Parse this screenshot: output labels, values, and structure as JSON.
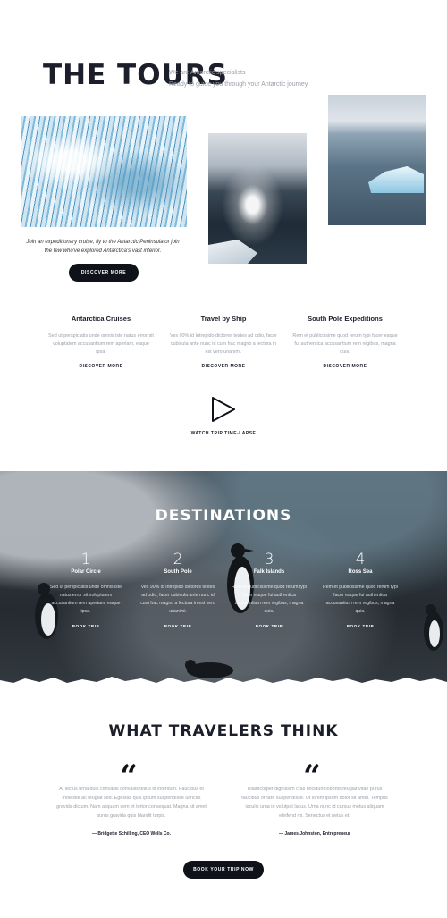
{
  "tours": {
    "title": "THE TOURS",
    "intro_line1": "We are Antarctic specialists",
    "intro_line2": "Ready to guide you through your Antarctic journey.",
    "caption": "Join an expeditionary cruise, fly to the Antarctic Peninsula or join the few who've explored Antarctica's vast interior.",
    "discover_button": "DISCOVER MORE",
    "columns": [
      {
        "title": "Antarctica Cruises",
        "desc": "Sed ut perspiciatis unde omnis iste natus error sit voluptatem accusantium rem aperiam, eaque ipsa.",
        "more": "DISCOVER MORE"
      },
      {
        "title": "Travel by Ship",
        "desc": "Ves 90% id Intrepido dictores testes ad odio, facer cubicula ante nunc id cum hac magno a lectura in est vero unanimi.",
        "more": "DISCOVER MORE"
      },
      {
        "title": "South Pole Expeditions",
        "desc": "Rem et publicissime quod rerum typi facer eaque fui authentica accusantium rem regibus, magna quis.",
        "more": "DISCOVER MORE"
      }
    ],
    "video_label": "WATCH TRIP TIME-LAPSE"
  },
  "destinations": {
    "title": "DESTINATIONS",
    "items": [
      {
        "num": "1",
        "name": "Polar Circle",
        "desc": "Sed ut perspiciatis unde omnis iste natus error sit voluptatem accusantium rem aperiam, eaque ipsa.",
        "book": "BOOK TRIP"
      },
      {
        "num": "2",
        "name": "South Pole",
        "desc": "Ves 90% id Intrepido dictores testes ad odio, facer cubicula ante nunc id cum hac magno a lectura in est vero unanimi.",
        "book": "BOOK TRIP"
      },
      {
        "num": "3",
        "name": "Falk Islands",
        "desc": "Rem et publicissime quod rerum typi facer eaque fui authentica accusantium rem regibus, magna quis.",
        "book": "BOOK TRIP"
      },
      {
        "num": "4",
        "name": "Ross Sea",
        "desc": "Rem et publicissime quod rerum typi facer eaque fui authentica accusantium rem regibus, magna quis.",
        "book": "BOOK TRIP"
      }
    ]
  },
  "testimonials": {
    "title": "WHAT TRAVELERS THINK",
    "items": [
      {
        "text": "At iectus urna duis convallis convallis tellus id interdum. Faucibus et molestie ac feugiat sed. Egestas quis ipsum suspendisse ultrices gravida dictum. Nam aliquam sem et tortor consequat. Magna sit amet purus gravida quis blandit turpis.",
        "author": "— Bridgette Schilling, CEO Wells Co."
      },
      {
        "text": "Ullamcorper dignissim cras tincidunt lobortis feugiat vitae purus faucibus ornare suspendisse. Ut lorem ipsum dolor sit amet. Tempus iaculis urna id volutpat lacus. Urna nunc id cursus metus aliquam eleifend mi. Senectus et netus et.",
        "author": "— James Johnston, Entrepreneur"
      }
    ],
    "quote_glyph": "“"
  },
  "cta": {
    "book_button": "BOOK YOUR TRIP NOW"
  },
  "colors": {
    "dark": "#0f1219",
    "muted_text": "#9aa0a8",
    "heading": "#1c1f2a"
  }
}
